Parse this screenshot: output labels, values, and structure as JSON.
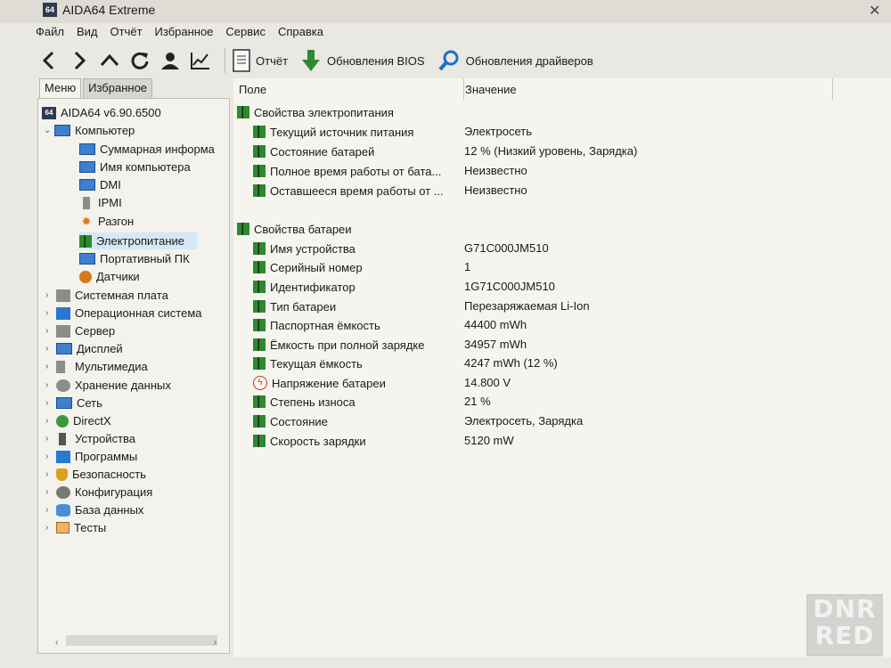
{
  "window": {
    "title": "AIDA64 Extreme",
    "app_icon_text": "64"
  },
  "menu": [
    "Файл",
    "Вид",
    "Отчёт",
    "Избранное",
    "Сервис",
    "Справка"
  ],
  "toolbar": {
    "report": "Отчёт",
    "bios_updates": "Обновления BIOS",
    "driver_updates": "Обновления драйверов"
  },
  "tabs": {
    "menu": "Меню",
    "favorites": "Избранное"
  },
  "tree": {
    "root": "AIDA64 v6.90.6500",
    "computer": "Компьютер",
    "computer_children": [
      "Суммарная информа",
      "Имя компьютера",
      "DMI",
      "IPMI",
      "Разгон",
      "Электропитание",
      "Портативный ПК",
      "Датчики"
    ],
    "top_level": [
      "Системная плата",
      "Операционная система",
      "Сервер",
      "Дисплей",
      "Мультимедиа",
      "Хранение данных",
      "Сеть",
      "DirectX",
      "Устройства",
      "Программы",
      "Безопасность",
      "Конфигурация",
      "База данных",
      "Тесты"
    ]
  },
  "columns": {
    "field": "Поле",
    "value": "Значение"
  },
  "sections": [
    {
      "title": "Свойства электропитания",
      "rows": [
        {
          "field": "Текущий источник питания",
          "value": "Электросеть"
        },
        {
          "field": "Состояние батарей",
          "value": "12 % (Низкий уровень, Зарядка)"
        },
        {
          "field": "Полное время работы от бата...",
          "value": "Неизвестно"
        },
        {
          "field": "Оставшееся время работы от ...",
          "value": "Неизвестно"
        }
      ]
    },
    {
      "title": "Свойства батареи",
      "rows": [
        {
          "field": "Имя устройства",
          "value": "G71C000JM510"
        },
        {
          "field": "Серийный номер",
          "value": "1"
        },
        {
          "field": "Идентификатор",
          "value": "1G71C000JM510"
        },
        {
          "field": "Тип батареи",
          "value": "Перезаряжаемая Li-Ion"
        },
        {
          "field": "Паспортная ёмкость",
          "value": "44400 mWh"
        },
        {
          "field": "Ёмкость при полной зарядке",
          "value": "34957 mWh"
        },
        {
          "field": "Текущая ёмкость",
          "value": "4247 mWh  (12 %)"
        },
        {
          "field": "Напряжение батареи",
          "value": "14.800 V"
        },
        {
          "field": "Степень износа",
          "value": "21 %"
        },
        {
          "field": "Состояние",
          "value": "Электросеть, Зарядка"
        },
        {
          "field": "Скорость зарядки",
          "value": "5120 mW"
        }
      ]
    }
  ],
  "watermark": "DNR RED"
}
